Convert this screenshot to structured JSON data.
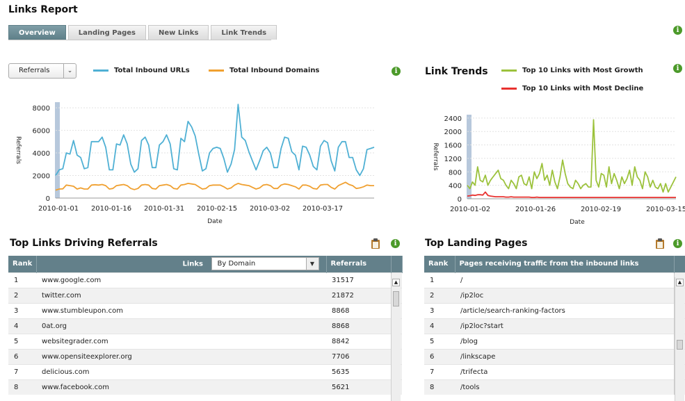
{
  "page": {
    "title": "Links Report",
    "tabs": [
      "Overview",
      "Landing Pages",
      "New Links",
      "Link Trends"
    ],
    "active_tab": "Overview"
  },
  "referrals_chart": {
    "select_value": "Referrals",
    "legend": [
      {
        "label": "Total Inbound URLs",
        "color": "#4fb0d4"
      },
      {
        "label": "Total Inbound Domains",
        "color": "#f0a030"
      }
    ]
  },
  "trends_chart": {
    "title": "Link Trends",
    "legend": [
      {
        "label": "Top 10 Links with Most Growth",
        "color": "#9cc23c"
      },
      {
        "label": "Top 10 Links with Most Decline",
        "color": "#e8312f"
      }
    ]
  },
  "chart_data": [
    {
      "type": "line",
      "ylabel": "Referrals",
      "xlabel": "Date",
      "ylim": [
        0,
        8500
      ],
      "yticks": [
        0,
        2000,
        4000,
        6000,
        8000
      ],
      "xticks": [
        "2010-01-01",
        "2010-01-16",
        "2010-01-31",
        "2010-02-15",
        "2010-03-02",
        "2010-03-17"
      ],
      "grid": true,
      "series": [
        {
          "name": "Total Inbound URLs",
          "color": "#4fb0d4",
          "values": [
            2000,
            2500,
            2600,
            4000,
            3900,
            5100,
            3800,
            3600,
            2600,
            2700,
            5000,
            5000,
            5000,
            5400,
            4500,
            2500,
            2500,
            4800,
            4700,
            5600,
            4800,
            3000,
            2300,
            2600,
            5100,
            5400,
            4700,
            2700,
            2700,
            4700,
            5000,
            5600,
            4800,
            2600,
            2500,
            5300,
            5000,
            6800,
            6300,
            5500,
            3900,
            2400,
            2600,
            4000,
            4400,
            4500,
            4400,
            3500,
            2300,
            3000,
            4300,
            8300,
            5400,
            5100,
            4100,
            3300,
            2500,
            3300,
            4200,
            4500,
            4000,
            2700,
            2700,
            4400,
            5400,
            5300,
            4100,
            3800,
            2500,
            4600,
            4500,
            3800,
            2800,
            2500,
            4600,
            5100,
            4900,
            3300,
            2400,
            4500,
            5000,
            5000,
            3600,
            3600,
            2500,
            2000,
            2600,
            4300,
            4400,
            4500
          ]
        },
        {
          "name": "Total Inbound Domains",
          "color": "#f0a030",
          "values": [
            700,
            800,
            820,
            1150,
            1100,
            1050,
            800,
            900,
            800,
            800,
            1150,
            1180,
            1150,
            1200,
            1100,
            800,
            850,
            1100,
            1150,
            1200,
            1100,
            850,
            750,
            850,
            1150,
            1200,
            1150,
            850,
            800,
            1100,
            1150,
            1200,
            1100,
            850,
            800,
            1150,
            1200,
            1300,
            1250,
            1200,
            1000,
            800,
            850,
            1100,
            1150,
            1150,
            1150,
            1000,
            800,
            900,
            1150,
            1300,
            1200,
            1150,
            1100,
            950,
            800,
            900,
            1150,
            1200,
            1100,
            850,
            850,
            1150,
            1250,
            1200,
            1100,
            1000,
            800,
            1150,
            1150,
            1050,
            850,
            800,
            1150,
            1200,
            1200,
            950,
            800,
            1100,
            1250,
            1400,
            1200,
            1100,
            850,
            900,
            1000,
            1150,
            1100,
            1100
          ]
        }
      ]
    },
    {
      "type": "line",
      "ylabel": "Referrals",
      "xlabel": "Date",
      "ylim": [
        0,
        2500
      ],
      "yticks": [
        0,
        400,
        800,
        1200,
        1600,
        2000,
        2400
      ],
      "xticks": [
        "2010-01-02",
        "2010-01-26",
        "2010-02-19",
        "2010-03-15"
      ],
      "grid": true,
      "series": [
        {
          "name": "Top 10 Links with Most Growth",
          "color": "#9cc23c",
          "values": [
            400,
            300,
            500,
            400,
            950,
            550,
            500,
            700,
            400,
            550,
            650,
            750,
            850,
            600,
            550,
            400,
            300,
            550,
            450,
            300,
            650,
            700,
            450,
            400,
            650,
            300,
            800,
            600,
            750,
            1050,
            550,
            700,
            400,
            850,
            500,
            300,
            650,
            1150,
            750,
            450,
            350,
            300,
            550,
            450,
            300,
            400,
            450,
            350,
            350,
            2350,
            550,
            350,
            750,
            700,
            350,
            950,
            450,
            750,
            550,
            300,
            650,
            450,
            600,
            850,
            400,
            950,
            650,
            550,
            300,
            800,
            650,
            350,
            550,
            350,
            300,
            450,
            200,
            450,
            200,
            350,
            500,
            650
          ]
        },
        {
          "name": "Top 10 Links with Most Decline",
          "color": "#e8312f",
          "values": [
            80,
            90,
            110,
            100,
            120,
            120,
            110,
            200,
            100,
            80,
            70,
            60,
            60,
            60,
            60,
            50,
            50,
            60,
            50,
            50,
            50,
            50,
            50,
            50,
            50,
            40,
            40,
            50,
            40,
            40,
            40,
            40,
            40,
            40,
            40,
            40,
            40,
            40,
            40,
            40,
            40,
            40,
            40,
            40,
            40,
            40,
            40,
            40,
            40,
            40,
            40,
            40,
            40,
            40,
            40,
            40,
            40,
            40,
            40,
            40,
            40,
            40,
            40,
            40,
            40,
            40,
            40,
            40,
            40,
            40,
            40,
            40,
            40,
            40,
            40,
            40,
            40,
            40,
            40,
            40,
            40,
            40
          ]
        }
      ]
    }
  ],
  "referrals_table": {
    "title": "Top Links Driving Referrals",
    "headers": {
      "rank": "Rank",
      "links": "Links",
      "referrals": "Referrals"
    },
    "filter_value": "By Domain",
    "rows": [
      {
        "rank": "1",
        "link": "www.google.com",
        "referrals": "31517"
      },
      {
        "rank": "2",
        "link": "twitter.com",
        "referrals": "21872"
      },
      {
        "rank": "3",
        "link": "www.stumbleupon.com",
        "referrals": "8868"
      },
      {
        "rank": "4",
        "link": "0at.org",
        "referrals": "8868"
      },
      {
        "rank": "5",
        "link": "websitegrader.com",
        "referrals": "8842"
      },
      {
        "rank": "6",
        "link": "www.opensiteexplorer.org",
        "referrals": "7706"
      },
      {
        "rank": "7",
        "link": "delicious.com",
        "referrals": "5635"
      },
      {
        "rank": "8",
        "link": "www.facebook.com",
        "referrals": "5621"
      }
    ]
  },
  "landing_table": {
    "title": "Top Landing Pages",
    "headers": {
      "rank": "Rank",
      "pages": "Pages receiving traffic from the inbound links"
    },
    "rows": [
      {
        "rank": "1",
        "page": "/"
      },
      {
        "rank": "2",
        "page": "/ip2loc"
      },
      {
        "rank": "3",
        "page": "/article/search-ranking-factors"
      },
      {
        "rank": "4",
        "page": "/ip2loc?start"
      },
      {
        "rank": "5",
        "page": "/blog"
      },
      {
        "rank": "6",
        "page": "/linkscape"
      },
      {
        "rank": "7",
        "page": "/trifecta"
      },
      {
        "rank": "8",
        "page": "/tools"
      }
    ]
  },
  "icons": {
    "info": "info-icon",
    "clipboard": "clipboard-icon",
    "info_glyph": "i"
  }
}
